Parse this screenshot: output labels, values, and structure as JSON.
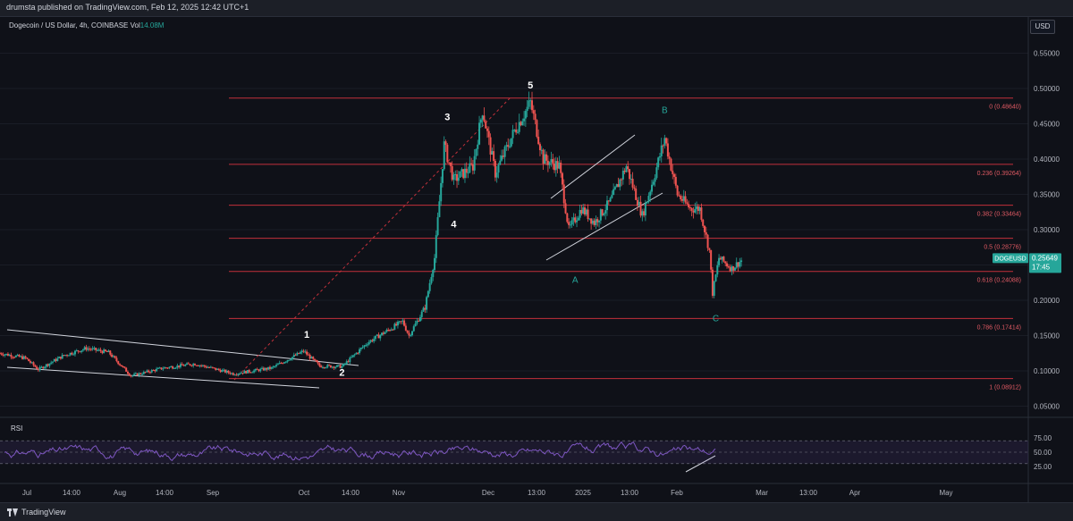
{
  "header": {
    "published_by": "drumsta published on TradingView.com, Feb 12, 2025 12:42 UTC+1"
  },
  "legend": {
    "symbol_name": "Dogecoin / US Dollar, 4h, COINBASE",
    "vol_label": "Vol",
    "vol_value": "14.08M"
  },
  "currency_button": "USD",
  "price_tag": {
    "symbol": "DOGEUSD",
    "price": "0.25649",
    "countdown": "17:45"
  },
  "rsi_label": "RSI",
  "branding": "TradingView",
  "colors": {
    "background": "#0f1118",
    "up": "#26a69a",
    "down": "#ef5350",
    "fib_line": "#c2313b",
    "rsi_line": "#7e57c2",
    "wave_label": "#ffffff",
    "abc_label": "#26a69a"
  },
  "chart_data": [
    {
      "type": "candlestick",
      "symbol": "DOGEUSD",
      "interval": "4h",
      "y_axis_ticks": [
        "0.55000",
        "0.50000",
        "0.45000",
        "0.40000",
        "0.35000",
        "0.30000",
        "0.25000",
        "0.20000",
        "0.15000",
        "0.10000",
        "0.05000"
      ],
      "ylim": [
        0.05,
        0.55
      ],
      "x_tick_labels": [
        "Jul",
        "14:00",
        "Aug",
        "14:00",
        "Sep",
        "Oct",
        "14:00",
        "Nov",
        "Dec",
        "13:00",
        "2025",
        "13:00",
        "Feb",
        "Mar",
        "13:00",
        "Apr",
        "May"
      ],
      "last_price": 0.25649,
      "price_path": [
        {
          "date": "2024-06-25",
          "close": 0.125
        },
        {
          "date": "2024-07-03",
          "close": 0.118
        },
        {
          "date": "2024-07-07",
          "close": 0.102
        },
        {
          "date": "2024-07-15",
          "close": 0.122
        },
        {
          "date": "2024-07-22",
          "close": 0.132
        },
        {
          "date": "2024-07-29",
          "close": 0.126
        },
        {
          "date": "2024-08-05",
          "close": 0.093
        },
        {
          "date": "2024-08-15",
          "close": 0.104
        },
        {
          "date": "2024-08-25",
          "close": 0.11
        },
        {
          "date": "2024-09-06",
          "close": 0.096
        },
        {
          "date": "2024-09-18",
          "close": 0.104
        },
        {
          "date": "2024-09-28",
          "close": 0.128
        },
        {
          "date": "2024-10-03",
          "close": 0.107
        },
        {
          "date": "2024-10-10",
          "close": 0.106
        },
        {
          "date": "2024-10-18",
          "close": 0.14
        },
        {
          "date": "2024-10-29",
          "close": 0.17
        },
        {
          "date": "2024-10-31",
          "close": 0.15
        },
        {
          "date": "2024-11-05",
          "close": 0.19
        },
        {
          "date": "2024-11-08",
          "close": 0.26
        },
        {
          "date": "2024-11-11",
          "close": 0.42
        },
        {
          "date": "2024-11-14",
          "close": 0.37
        },
        {
          "date": "2024-11-20",
          "close": 0.39
        },
        {
          "date": "2024-11-23",
          "close": 0.47
        },
        {
          "date": "2024-11-27",
          "close": 0.38
        },
        {
          "date": "2024-12-03",
          "close": 0.44
        },
        {
          "date": "2024-12-08",
          "close": 0.48
        },
        {
          "date": "2024-12-12",
          "close": 0.4
        },
        {
          "date": "2024-12-17",
          "close": 0.39
        },
        {
          "date": "2024-12-20",
          "close": 0.3
        },
        {
          "date": "2024-12-24",
          "close": 0.33
        },
        {
          "date": "2024-12-28",
          "close": 0.31
        },
        {
          "date": "2025-01-02",
          "close": 0.34
        },
        {
          "date": "2025-01-07",
          "close": 0.39
        },
        {
          "date": "2025-01-12",
          "close": 0.32
        },
        {
          "date": "2025-01-16",
          "close": 0.38
        },
        {
          "date": "2025-01-19",
          "close": 0.43
        },
        {
          "date": "2025-01-23",
          "close": 0.35
        },
        {
          "date": "2025-01-27",
          "close": 0.33
        },
        {
          "date": "2025-01-30",
          "close": 0.33
        },
        {
          "date": "2025-02-02",
          "close": 0.27
        },
        {
          "date": "2025-02-03",
          "close": 0.21
        },
        {
          "date": "2025-02-05",
          "close": 0.26
        },
        {
          "date": "2025-02-09",
          "close": 0.245
        },
        {
          "date": "2025-02-12",
          "close": 0.25649
        }
      ],
      "fibonacci_levels": [
        {
          "label": "0 (0.48640)",
          "value": 0.4864
        },
        {
          "label": "0.236 (0.39264)",
          "value": 0.39264
        },
        {
          "label": "0.382 (0.33464)",
          "value": 0.33464
        },
        {
          "label": "0.5 (0.28776)",
          "value": 0.28776
        },
        {
          "label": "0.618 (0.24088)",
          "value": 0.24088
        },
        {
          "label": "0.786 (0.17414)",
          "value": 0.17414
        },
        {
          "label": "1 (0.08912)",
          "value": 0.08912
        }
      ],
      "wave_labels": [
        {
          "text": "1",
          "date": "2024-09-29",
          "price": 0.147
        },
        {
          "text": "2",
          "date": "2024-10-10",
          "price": 0.093
        },
        {
          "text": "3",
          "date": "2024-11-12",
          "price": 0.455
        },
        {
          "text": "4",
          "date": "2024-11-14",
          "price": 0.303
        },
        {
          "text": "5",
          "date": "2024-12-08",
          "price": 0.5
        },
        {
          "text": "A",
          "date": "2024-12-22",
          "price": 0.225
        },
        {
          "text": "B",
          "date": "2025-01-19",
          "price": 0.465
        },
        {
          "text": "C",
          "date": "2025-02-04",
          "price": 0.17
        }
      ]
    },
    {
      "type": "line",
      "name": "RSI",
      "y_axis_ticks": [
        "75.00",
        "50.00",
        "25.00"
      ],
      "ylim": [
        20,
        85
      ],
      "bands": [
        70,
        50,
        30
      ]
    }
  ]
}
